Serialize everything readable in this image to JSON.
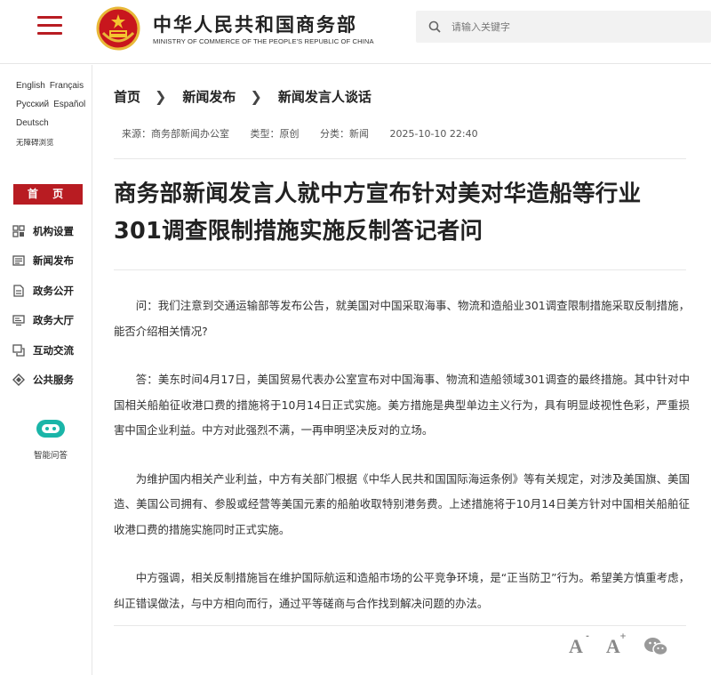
{
  "header": {
    "ministry_cn": "中华人民共和国商务部",
    "ministry_en": "MINISTRY OF COMMERCE OF THE PEOPLE'S REPUBLIC OF CHINA",
    "search_placeholder": "请输入关键字",
    "brand_color": "#b81c22"
  },
  "sidebar": {
    "languages": [
      "English",
      "Français",
      "Русский",
      "Español",
      "Deutsch"
    ],
    "accessible": "无障碍浏览",
    "home": "首 页",
    "items": [
      {
        "label": "机构设置",
        "icon": "org-chart-icon"
      },
      {
        "label": "新闻发布",
        "icon": "news-icon"
      },
      {
        "label": "政务公开",
        "icon": "document-icon"
      },
      {
        "label": "政务大厅",
        "icon": "monitor-icon"
      },
      {
        "label": "互动交流",
        "icon": "chat-icon"
      },
      {
        "label": "公共服务",
        "icon": "service-icon"
      }
    ],
    "assistant_label": "智能问答"
  },
  "breadcrumb": [
    "首页",
    "新闻发布",
    "新闻发言人谈话"
  ],
  "meta": {
    "source": "来源：商务部新闻办公室",
    "type": "类型：原创",
    "category": "分类：新闻",
    "date": "2025-10-10 22:40"
  },
  "article": {
    "title": "商务部新闻发言人就中方宣布针对美对华造船等行业301调查限制措施实施反制答记者问",
    "paragraphs": [
      "问：我们注意到交通运输部等发布公告，就美国对中国采取海事、物流和造船业301调查限制措施采取反制措施，能否介绍相关情况?",
      "答：美东时间4月17日，美国贸易代表办公室宣布对中国海事、物流和造船领域301调查的最终措施。其中针对中国相关船舶征收港口费的措施将于10月14日正式实施。美方措施是典型单边主义行为，具有明显歧视性色彩，严重损害中国企业利益。中方对此强烈不满，一再申明坚决反对的立场。",
      "为维护国内相关产业利益，中方有关部门根据《中华人民共和国国际海运条例》等有关规定，对涉及美国旗、美国造、美国公司拥有、参股或经营等美国元素的船舶收取特别港务费。上述措施将于10月14日美方针对中国相关船舶征收港口费的措施实施同时正式实施。",
      "中方强调，相关反制措施旨在维护国际航运和造船市场的公平竞争环境，是“正当防卫”行为。希望美方慎重考虑，纠正错误做法，与中方相向而行，通过平等磋商与合作找到解决问题的办法。"
    ]
  },
  "tools": {
    "font_decrease": "A",
    "font_decrease_sign": "-",
    "font_increase": "A",
    "font_increase_sign": "+"
  }
}
